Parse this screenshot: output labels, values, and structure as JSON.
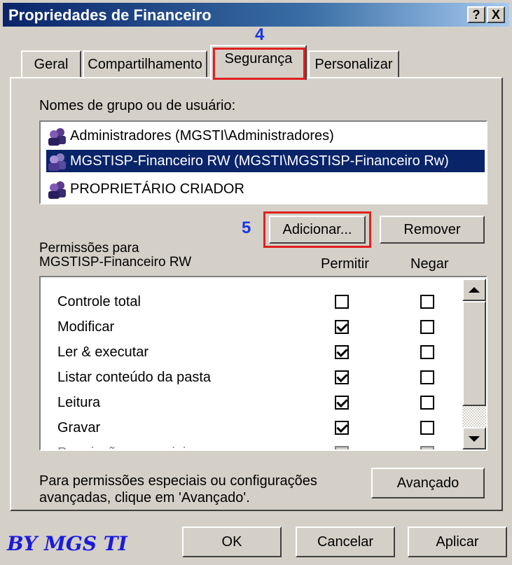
{
  "window": {
    "title": "Propriedades de Financeiro",
    "help_button": "?",
    "close_button": "X"
  },
  "tabs": [
    {
      "label": "Geral",
      "active": false
    },
    {
      "label": "Compartilhamento",
      "active": false
    },
    {
      "label": "Segurança",
      "active": true
    },
    {
      "label": "Personalizar",
      "active": false
    }
  ],
  "annotations": {
    "step_tab": "4",
    "step_add": "5",
    "highlight_color": "#e0201f",
    "step_color": "#1a36e6"
  },
  "groups": {
    "label": "Nomes de grupo ou de usuário:",
    "items": [
      {
        "name": "Administradores (MGSTI\\Administradores)",
        "icon": "users-icon",
        "selected": false
      },
      {
        "name": "MGSTISP-Financeiro RW (MGSTI\\MGSTISP-Financeiro Rw)",
        "icon": "users-icon",
        "selected": true
      },
      {
        "name": "PROPRIETÁRIO CRIADOR",
        "icon": "users-icon",
        "selected": false
      }
    ]
  },
  "buttons": {
    "add": "Adicionar...",
    "remove": "Remover",
    "advanced": "Avançado",
    "ok": "OK",
    "cancel": "Cancelar",
    "apply": "Aplicar"
  },
  "permissions": {
    "label_line1": "Permissões para",
    "label_line2": "MGSTISP-Financeiro RW",
    "allow_header": "Permitir",
    "deny_header": "Negar",
    "rows": [
      {
        "name": "Controle total",
        "allow": false,
        "deny": false
      },
      {
        "name": "Modificar",
        "allow": true,
        "deny": false
      },
      {
        "name": "Ler & executar",
        "allow": true,
        "deny": false
      },
      {
        "name": "Listar conteúdo da pasta",
        "allow": true,
        "deny": false
      },
      {
        "name": "Leitura",
        "allow": true,
        "deny": false
      },
      {
        "name": "Gravar",
        "allow": true,
        "deny": false
      },
      {
        "name": "Permissões especiais",
        "allow": false,
        "deny": false
      }
    ]
  },
  "advanced_text": {
    "line1": "Para permissões especiais ou configurações",
    "line2": "avançadas, clique em 'Avançado'."
  },
  "watermark": "BY MGS TI"
}
